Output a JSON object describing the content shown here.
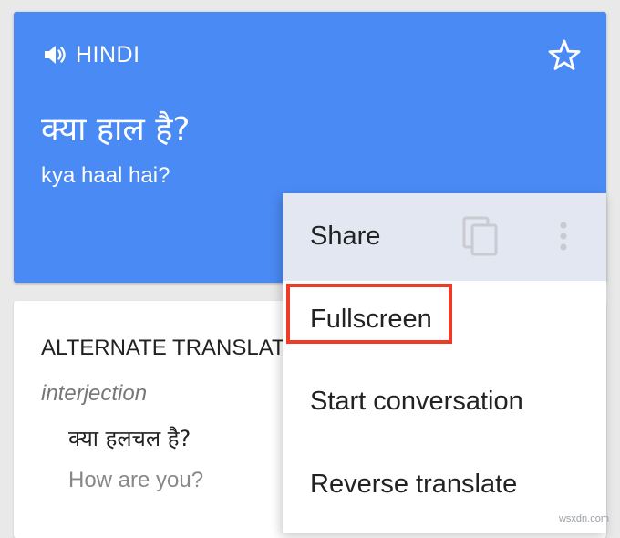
{
  "translation": {
    "language": "HINDI",
    "source_text": "क्या हाल है?",
    "romanized": "kya haal hai?",
    "accent_color": "#4a8af4",
    "speaker_icon": "speaker-icon",
    "favorite_icon": "star-outline-icon"
  },
  "alternate": {
    "title": "ALTERNATE TRANSLATIONS",
    "part_of_speech": "interjection",
    "word": "क्या हलचल है?",
    "meaning": "How are you?"
  },
  "menu": {
    "items": [
      "Share",
      "Fullscreen",
      "Start conversation",
      "Reverse translate"
    ],
    "copy_icon": "copy-icon",
    "more_icon": "more-vert-icon",
    "highlighted_item": "Fullscreen",
    "highlight_color": "#f03a28"
  },
  "watermark": "wsxdn.com"
}
